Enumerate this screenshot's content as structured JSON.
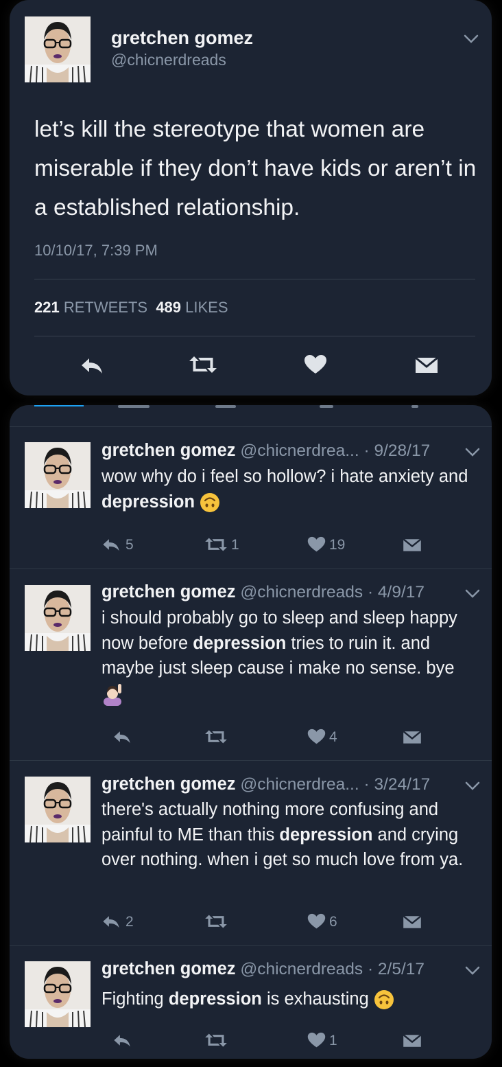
{
  "main_tweet": {
    "name": "gretchen gomez",
    "handle": "@chicnerdreads",
    "text": "let’s kill the stereotype that women are miserable if they don’t have kids or aren’t in a established relationship.",
    "timestamp": "10/10/17, 7:39 PM",
    "retweets_count": "221",
    "retweets_label": "RETWEETS",
    "likes_count": "489",
    "likes_label": "LIKES"
  },
  "tweets": [
    {
      "name": "gretchen gomez",
      "handle": "@chicnerdrea...",
      "date": "· 9/28/17",
      "text_before": "wow why do i feel so hollow? i hate anxiety and ",
      "highlight": "depression",
      "text_after": " ",
      "emoji": "upside-down-face-icon",
      "replies": "5",
      "retweets": "1",
      "likes": "19"
    },
    {
      "name": "gretchen gomez",
      "handle": "@chicnerdreads",
      "date": "· 4/9/17",
      "text_before": "i should probably go to sleep and sleep happy now before ",
      "highlight": "depression",
      "text_after": " tries to ruin it. and maybe just sleep cause i make no sense. bye ",
      "emoji": "person-raising-hand-icon",
      "replies": "",
      "retweets": "",
      "likes": "4"
    },
    {
      "name": "gretchen gomez",
      "handle": "@chicnerdrea...",
      "date": "· 3/24/17",
      "text_before": "there's actually nothing more confusing and painful to ME than this ",
      "highlight": "depression",
      "text_after": " and crying over nothing. when i get so much love from ya.",
      "emoji": "",
      "replies": "2",
      "retweets": "",
      "likes": "6"
    },
    {
      "name": "gretchen gomez",
      "handle": "@chicnerdreads",
      "date": "· 2/5/17",
      "text_before": "Fighting ",
      "highlight": "depression",
      "text_after": " is exhausting ",
      "emoji": "upside-down-face-icon",
      "replies": "",
      "retweets": "",
      "likes": "1"
    }
  ],
  "colors": {
    "card_bg": "#1c2433",
    "text": "#f2f3f5",
    "secondary": "#8a97a8",
    "accent": "#1da1f2"
  }
}
